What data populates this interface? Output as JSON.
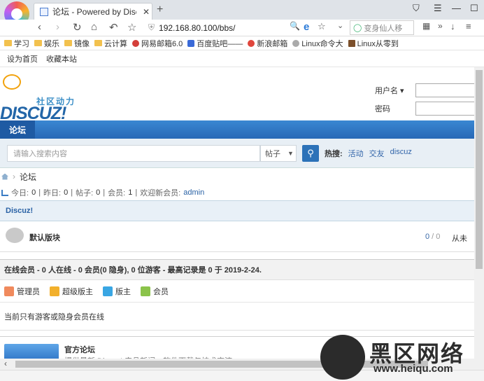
{
  "browser": {
    "tab_title": "论坛 - Powered by Discuz!",
    "address": "192.168.80.100/bbs/",
    "search_placeholder": "变身仙人移"
  },
  "bookmarks": [
    "学习",
    "娱乐",
    "镜像",
    "云计算",
    "网易邮箱6.0",
    "百度贴吧——",
    "新浪邮箱",
    "Linux命令大",
    "Linux从零到"
  ],
  "site": {
    "top_links": [
      "设为首页",
      "收藏本站"
    ],
    "logo_slogan": "社区动力",
    "logo_word": "DISCUZ!",
    "login": {
      "username_label": "用户名",
      "password_label": "密码"
    },
    "nav_current": "论坛",
    "search": {
      "placeholder": "请输入搜索内容",
      "type": "帖子",
      "hot_label": "热搜:",
      "hot_terms": [
        "活动",
        "交友",
        "discuz"
      ]
    },
    "breadcrumb": "论坛",
    "stats": {
      "today_label": "今日:",
      "today": "0",
      "yesterday_label": "昨日:",
      "yesterday": "0",
      "posts_label": "帖子:",
      "posts": "0",
      "members_label": "会员:",
      "members": "1",
      "welcome_label": "欢迎新会员:",
      "newest": "admin"
    },
    "section_title": "Discuz!",
    "forum": {
      "name": "默认版块",
      "count": "0",
      "count_sep": " / ",
      "posts": "0",
      "last": "从未"
    },
    "online_header": "在线会员 - 0 人在线 - 0 会员(0 隐身), 0 位游客 - 最高记录是 0 于 2019-2-24.",
    "legend": [
      "管理员",
      "超级版主",
      "版主",
      "会员"
    ],
    "online_msg": "当前只有游客或隐身会员在线",
    "official": {
      "name": "官方论坛",
      "desc": "提供最新 Discuz! 产品新闻、软件下载与技术交流"
    }
  },
  "watermark": {
    "cn": "黑区网络",
    "url": "www.heiqu.com"
  },
  "colors": {
    "nav_blue": "#2868b6",
    "link": "#2a62a5",
    "legend": [
      "#f08a5d",
      "#f2b02c",
      "#39a6e3",
      "#8bc34a"
    ]
  }
}
